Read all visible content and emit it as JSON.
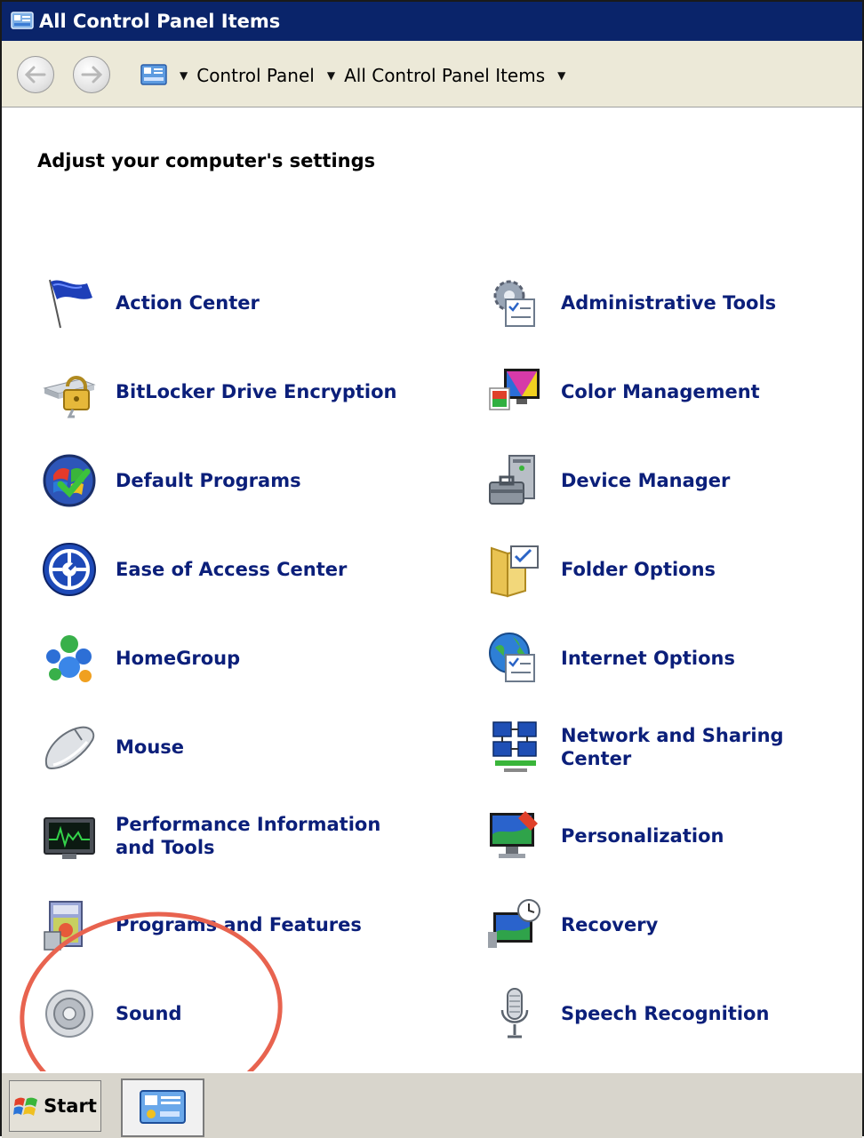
{
  "window": {
    "title": "All Control Panel Items"
  },
  "address": {
    "crumbs": [
      "Control Panel",
      "All Control Panel Items"
    ]
  },
  "content": {
    "heading": "Adjust your computer's settings",
    "items": [
      {
        "label": "Action Center",
        "icon": "flag-icon"
      },
      {
        "label": "Administrative Tools",
        "icon": "admin-tools-icon"
      },
      {
        "label": "BitLocker Drive Encryption",
        "icon": "bitlocker-icon"
      },
      {
        "label": "Color Management",
        "icon": "color-management-icon"
      },
      {
        "label": "Default Programs",
        "icon": "default-programs-icon"
      },
      {
        "label": "Device Manager",
        "icon": "device-manager-icon"
      },
      {
        "label": "Ease of Access Center",
        "icon": "ease-of-access-icon"
      },
      {
        "label": "Folder Options",
        "icon": "folder-options-icon"
      },
      {
        "label": "HomeGroup",
        "icon": "homegroup-icon"
      },
      {
        "label": "Internet Options",
        "icon": "internet-options-icon"
      },
      {
        "label": "Mouse",
        "icon": "mouse-icon"
      },
      {
        "label": "Network and Sharing Center",
        "icon": "network-icon"
      },
      {
        "label": "Performance Information and Tools",
        "icon": "performance-icon"
      },
      {
        "label": "Personalization",
        "icon": "personalization-icon"
      },
      {
        "label": "Programs and Features",
        "icon": "programs-icon"
      },
      {
        "label": "Recovery",
        "icon": "recovery-icon"
      },
      {
        "label": "Sound",
        "icon": "sound-icon"
      },
      {
        "label": "Speech Recognition",
        "icon": "microphone-icon"
      }
    ]
  },
  "taskbar": {
    "start_label": "Start"
  },
  "colors": {
    "titlebar": "#0a246a",
    "link": "#0b1f7a",
    "annotation": "#e8634f"
  }
}
